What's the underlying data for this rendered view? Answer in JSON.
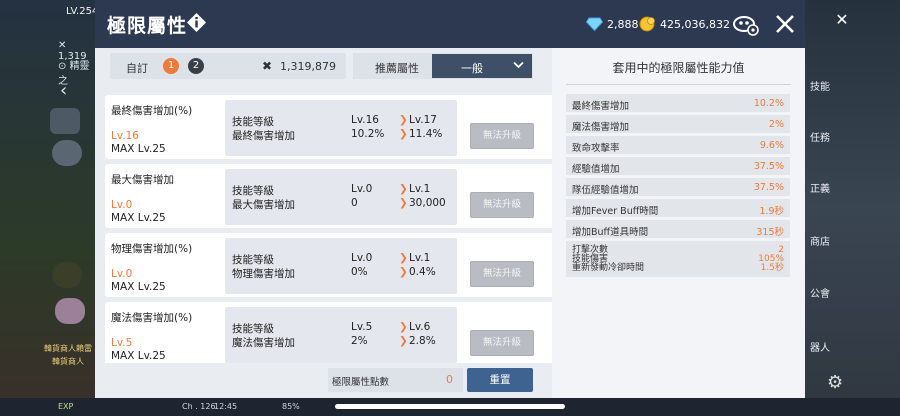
{
  "hud": {
    "level": "LV.254",
    "power": "1,319",
    "map_label": "精靈之",
    "ch": "Ch . 126",
    "time": "12:45",
    "battery": "85%",
    "exp": "EXP",
    "npc_name1": "韓貨商人賴雷",
    "npc_name2": "韓貨商人",
    "side_right": [
      "技能",
      "任務",
      "正義",
      "商店",
      "公會",
      "器人"
    ]
  },
  "dialog": {
    "title": "極限屬性",
    "currency_diamond": "2,888",
    "currency_gold": "425,036,832"
  },
  "preset": {
    "label": "自訂",
    "tabs": [
      "1",
      "2"
    ],
    "active_tab": 0,
    "combat_power": "1,319,879",
    "recommend_label": "推薦屬性",
    "recommend_value": "一般"
  },
  "abilities": [
    {
      "name": "最終傷害增加(%)",
      "level": "Lv.16",
      "max": "MAX Lv.25",
      "row1_label": "技能等級",
      "row2_label": "最終傷害增加",
      "row1_cur": "Lv.16",
      "row1_next": "Lv.17",
      "row2_cur": "10.2%",
      "row2_next": "11.4%",
      "button": "無法升級"
    },
    {
      "name": "最大傷害增加",
      "level": "Lv.0",
      "max": "MAX Lv.25",
      "row1_label": "技能等級",
      "row2_label": "最大傷害增加",
      "row1_cur": "Lv.0",
      "row1_next": "Lv.1",
      "row2_cur": "0",
      "row2_next": "30,000",
      "button": "無法升級"
    },
    {
      "name": "物理傷害增加(%)",
      "level": "Lv.0",
      "max": "MAX Lv.25",
      "row1_label": "技能等級",
      "row2_label": "物理傷害增加",
      "row1_cur": "Lv.0",
      "row1_next": "Lv.1",
      "row2_cur": "0%",
      "row2_next": "0.4%",
      "button": "無法升級"
    },
    {
      "name": "魔法傷害增加(%)",
      "level": "Lv.5",
      "max": "MAX Lv.25",
      "row1_label": "技能等級",
      "row2_label": "魔法傷害增加",
      "row1_cur": "Lv.5",
      "row1_next": "Lv.6",
      "row2_cur": "2%",
      "row2_next": "2.8%",
      "button": "無法升級"
    }
  ],
  "footer": {
    "points_label": "極限屬性點數",
    "points_value": "0",
    "reset_label": "重置"
  },
  "summary": {
    "title": "套用中的極限屬性能力值",
    "rows": [
      {
        "label": "最終傷害增加",
        "value": "10.2%"
      },
      {
        "label": "魔法傷害增加",
        "value": "2%"
      },
      {
        "label": "致命攻擊率",
        "value": "9.6%"
      },
      {
        "label": "經驗值增加",
        "value": "37.5%"
      },
      {
        "label": "隊伍經驗值增加",
        "value": "37.5%"
      },
      {
        "label": "增加Fever Buff時間",
        "value": "1.9秒"
      },
      {
        "label": "增加Buff道具時間",
        "value": "315秒"
      }
    ],
    "multi": {
      "labels": [
        "打擊次數",
        "技能傷害",
        "重新發動冷卻時間"
      ],
      "values": [
        "2",
        "105%",
        "1.5秒"
      ]
    }
  },
  "colors": {
    "accent": "#f07a3a",
    "header": "#2c3951",
    "dropdown": "#3e4f68",
    "reset": "#3e6390"
  }
}
